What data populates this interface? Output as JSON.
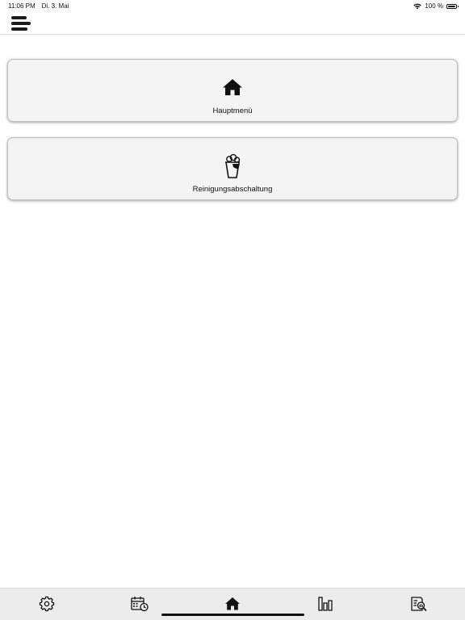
{
  "status_bar": {
    "time": "11:06 PM",
    "date": "Di. 3. Mai",
    "battery_text": "100 %",
    "wifi_icon": "wifi-icon",
    "battery_icon": "battery-icon",
    "battery_level": 1.0
  },
  "header": {
    "menu_icon": "hamburger-menu-icon"
  },
  "cards": [
    {
      "label": "Hauptmenü",
      "icon": "home-icon"
    },
    {
      "label": "Reinigungsabschaltung",
      "icon": "cleaning-bucket-icon"
    }
  ],
  "tab_bar": {
    "tabs": [
      {
        "icon": "gear-icon",
        "selected": false
      },
      {
        "icon": "calendar-clock-icon",
        "selected": false
      },
      {
        "icon": "home-icon",
        "selected": true
      },
      {
        "icon": "bar-chart-icon",
        "selected": false
      },
      {
        "icon": "report-search-icon",
        "selected": false
      }
    ]
  },
  "colors": {
    "card_background": "#f4f4f4",
    "tab_bar_background": "#ececec",
    "icon_color": "#111111"
  }
}
